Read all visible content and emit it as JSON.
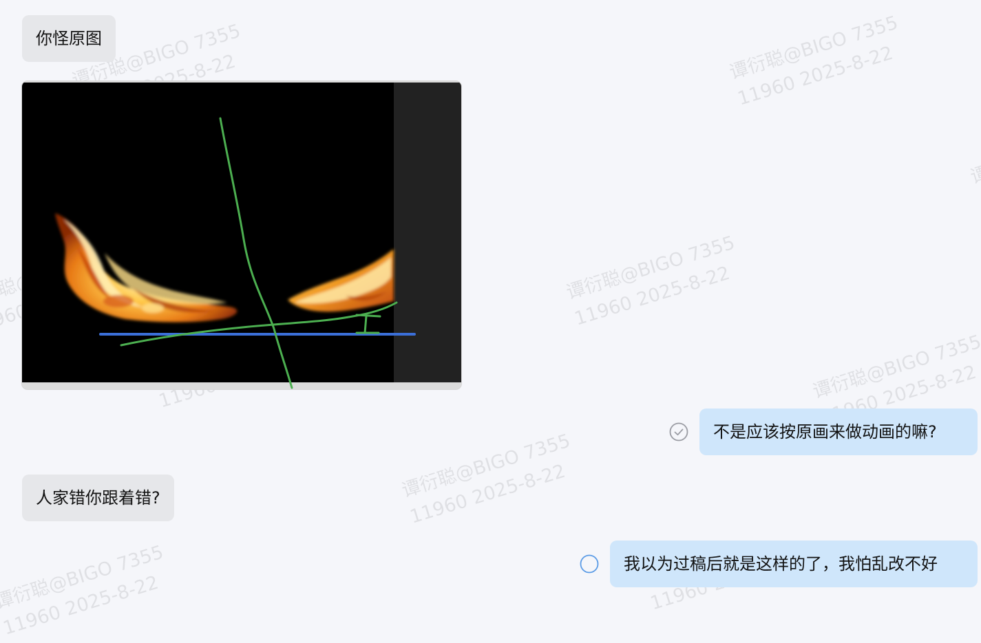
{
  "watermark": {
    "line1": "谭衍聪@BIGO 7355",
    "line2": "11960 2025-8-22"
  },
  "messages": [
    {
      "side": "incoming",
      "text": "你怪原图"
    },
    {
      "side": "incoming",
      "type": "image",
      "icon": "fire-sketch-image"
    },
    {
      "side": "outgoing",
      "text": "不是应该按原画来做动画的嘛?",
      "status": "read-check-icon"
    },
    {
      "side": "incoming",
      "text": "人家错你跟着错?"
    },
    {
      "side": "outgoing",
      "text": "我以为过稿后就是这样的了，我怕乱改不好",
      "status": "sending-circle-icon"
    }
  ],
  "colors": {
    "background": "#f5f6fa",
    "incoming_bubble": "#e6e7ea",
    "outgoing_bubble": "#cfe6fb",
    "sketch_green": "#4caf50",
    "sketch_blue": "#3b6fd8",
    "sending_circle": "#5a9be6"
  }
}
